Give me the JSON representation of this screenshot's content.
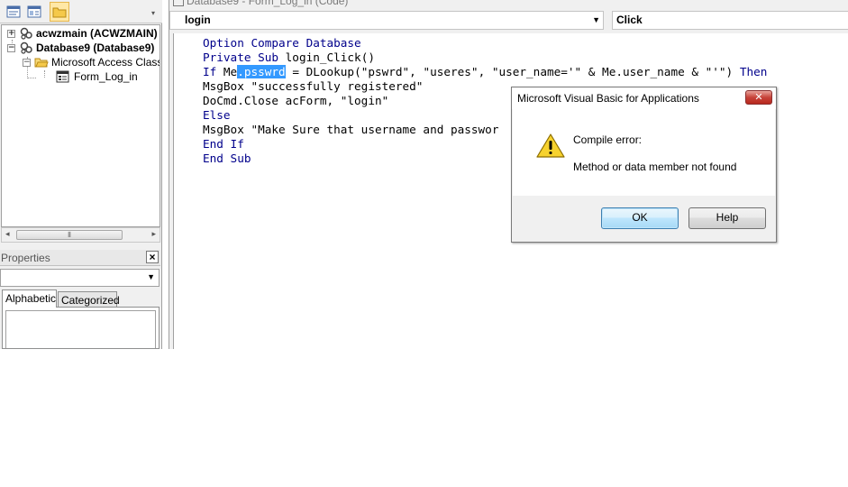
{
  "project": {
    "tree": [
      {
        "label": "acwzmain (ACWZMAIN)",
        "expander": "+"
      },
      {
        "label": "Database9 (Database9)",
        "expander": "−"
      },
      {
        "label": "Microsoft Access Class Objects",
        "expander": "−"
      },
      {
        "label": "Form_Log_in"
      }
    ]
  },
  "properties": {
    "title": "Properties",
    "tabs": [
      "Alphabetic",
      "Categorized"
    ]
  },
  "code_window": {
    "title": "Database9 - Form_Log_in (Code)",
    "object_combo": "login",
    "procedure_combo": "Click",
    "lines": {
      "l1": "Option Compare Database",
      "l2_kw": "Private Sub",
      "l2_rest": " login_Click()",
      "l3_kw1": "If",
      "l3_a": " Me",
      "l3_sel": ".psswrd",
      "l3_b": " = DLookup(\"pswrd\", \"useres\", \"user_name='\" & Me.user_name & \"'\") ",
      "l3_kw2": "Then",
      "l4": "MsgBox \"successfully registered\"",
      "l5": "DoCmd.Close acForm, \"login\"",
      "l6": "Else",
      "l7": "MsgBox \"Make Sure that username and passwor",
      "l8": "End If",
      "l9": "End Sub"
    }
  },
  "dialog": {
    "title": "Microsoft Visual Basic for Applications",
    "close_glyph": "✕",
    "line1": "Compile error:",
    "line2": "Method or data member not found",
    "ok_label": "OK",
    "help_label": "Help",
    "icon": "warning-icon"
  }
}
